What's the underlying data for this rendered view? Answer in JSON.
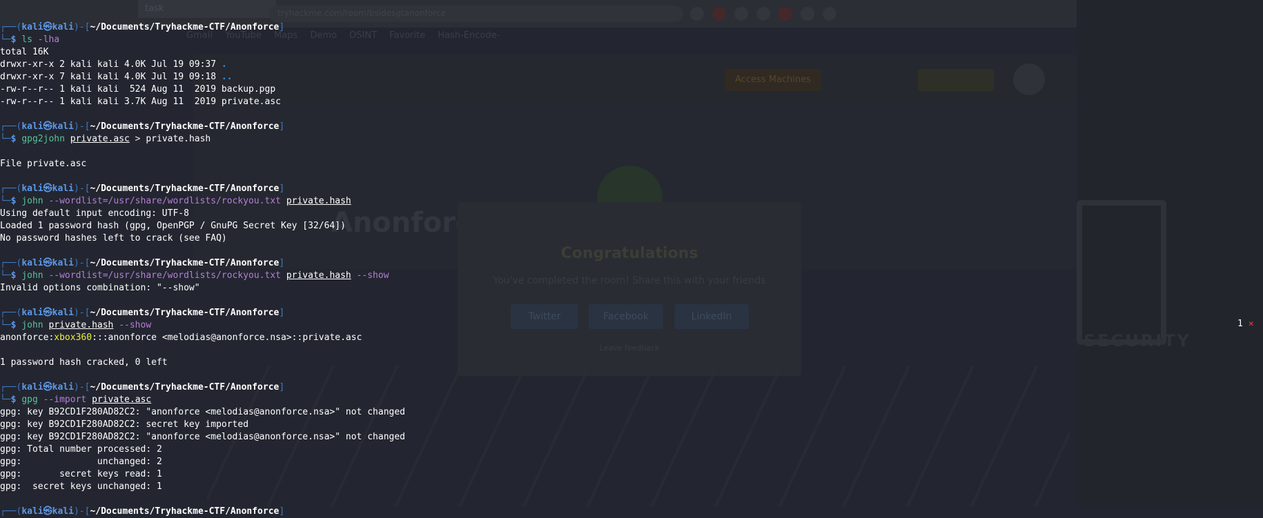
{
  "background_browser": {
    "tab_title": "task",
    "url": "tryhackme.com/room/bsidesgtanonforce",
    "bookmarks": "Gmail YouTube Maps Demo OSINT Favorite Hash-Encode-",
    "access_button": "Access Machines",
    "room_title": "Anonforce",
    "modal": {
      "title": "Congratulations",
      "message": "You've completed the room! Share this with your friends",
      "share_buttons": [
        "Twitter",
        "Facebook",
        "LinkedIn"
      ],
      "feedback": "Leave feedback"
    },
    "logo_text": "SECURITY"
  },
  "terminal": {
    "prompt": {
      "corner_top": "┌──(",
      "user": "kali㉿kali",
      "mid": ")-[",
      "cwd": "~/Documents/Tryhackme-CTF/Anonforce",
      "end": "]",
      "corner_bottom": "└─",
      "symbol": "$"
    },
    "blocks": [
      {
        "cmd": [
          {
            "t": "ls",
            "c": "cmd"
          },
          {
            "t": " "
          },
          {
            "t": "-lha",
            "c": "opt"
          }
        ],
        "output": [
          [
            {
              "t": "total 16K"
            }
          ],
          [
            {
              "t": "drwxr-xr-x 2 kali kali 4.0K Jul 19 09:37 "
            },
            {
              "t": ".",
              "c": "dir"
            }
          ],
          [
            {
              "t": "drwxr-xr-x 7 kali kali 4.0K Jul 19 09:18 "
            },
            {
              "t": "..",
              "c": "dir"
            }
          ],
          [
            {
              "t": "-rw-r--r-- 1 kali kali  524 Aug 11  2019 backup.pgp"
            }
          ],
          [
            {
              "t": "-rw-r--r-- 1 kali kali 3.7K Aug 11  2019 private.asc"
            }
          ],
          [
            {
              "t": ""
            }
          ]
        ]
      },
      {
        "cmd": [
          {
            "t": "gpg2john",
            "c": "cmd"
          },
          {
            "t": " "
          },
          {
            "t": "private.asc",
            "c": "file"
          },
          {
            "t": " > ",
            "c": "op"
          },
          {
            "t": "private.hash"
          }
        ],
        "output": [
          [
            {
              "t": ""
            }
          ],
          [
            {
              "t": "File private.asc"
            }
          ],
          [
            {
              "t": ""
            }
          ]
        ]
      },
      {
        "cmd": [
          {
            "t": "john",
            "c": "cmd"
          },
          {
            "t": " "
          },
          {
            "t": "--wordlist=/usr/share/wordlists/rockyou.txt",
            "c": "opt"
          },
          {
            "t": " "
          },
          {
            "t": "private.hash",
            "c": "file"
          }
        ],
        "output": [
          [
            {
              "t": "Using default input encoding: UTF-8"
            }
          ],
          [
            {
              "t": "Loaded 1 password hash (gpg, OpenPGP / GnuPG Secret Key [32/64])"
            }
          ],
          [
            {
              "t": "No password hashes left to crack (see FAQ)"
            }
          ],
          [
            {
              "t": ""
            }
          ]
        ]
      },
      {
        "cmd": [
          {
            "t": "john",
            "c": "cmd"
          },
          {
            "t": " "
          },
          {
            "t": "--wordlist=/usr/share/wordlists/rockyou.txt",
            "c": "opt"
          },
          {
            "t": " "
          },
          {
            "t": "private.hash",
            "c": "file"
          },
          {
            "t": " "
          },
          {
            "t": "--show",
            "c": "opt"
          }
        ],
        "output": [
          [
            {
              "t": "Invalid options combination: \"--show\""
            }
          ],
          [
            {
              "t": ""
            }
          ]
        ]
      },
      {
        "cmd": [
          {
            "t": "john",
            "c": "cmd"
          },
          {
            "t": " "
          },
          {
            "t": "private.hash",
            "c": "file"
          },
          {
            "t": " "
          },
          {
            "t": "--show",
            "c": "opt"
          }
        ],
        "output": [
          [
            {
              "t": "anonforce:"
            },
            {
              "t": "xbox360",
              "c": "pass"
            },
            {
              "t": ":::anonforce <melodias@anonforce.nsa>::private.asc"
            }
          ],
          [
            {
              "t": ""
            }
          ],
          [
            {
              "t": "1 password hash cracked, 0 left"
            }
          ],
          [
            {
              "t": ""
            }
          ]
        ]
      },
      {
        "cmd": [
          {
            "t": "gpg",
            "c": "cmd"
          },
          {
            "t": " "
          },
          {
            "t": "--import",
            "c": "opt"
          },
          {
            "t": " "
          },
          {
            "t": "private.asc",
            "c": "file"
          }
        ],
        "output": [
          [
            {
              "t": "gpg: key B92CD1F280AD82C2: \"anonforce <melodias@anonforce.nsa>\" not changed"
            }
          ],
          [
            {
              "t": "gpg: key B92CD1F280AD82C2: secret key imported"
            }
          ],
          [
            {
              "t": "gpg: key B92CD1F280AD82C2: \"anonforce <melodias@anonforce.nsa>\" not changed"
            }
          ],
          [
            {
              "t": "gpg: Total number processed: 2"
            }
          ],
          [
            {
              "t": "gpg:              unchanged: 2"
            }
          ],
          [
            {
              "t": "gpg:       secret keys read: 1"
            }
          ],
          [
            {
              "t": "gpg:  secret keys unchanged: 1"
            }
          ],
          [
            {
              "t": ""
            }
          ]
        ]
      },
      {
        "cmd": null,
        "output": []
      }
    ],
    "right_status": {
      "count": "1",
      "mark": "✕"
    }
  }
}
